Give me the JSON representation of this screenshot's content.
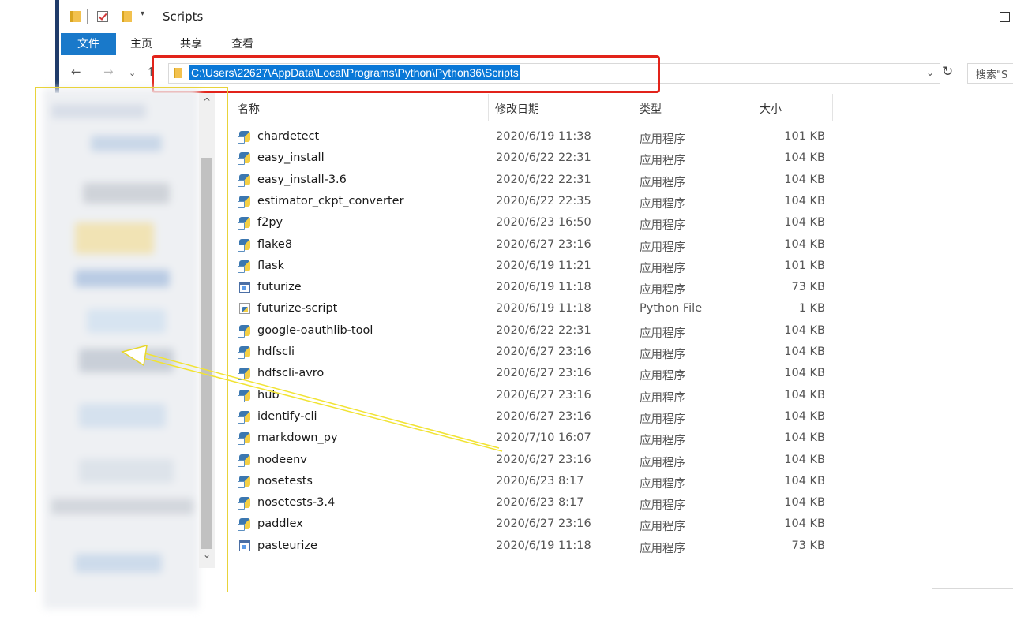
{
  "window": {
    "title": "Scripts",
    "quick_access_dropdown": "▾",
    "minimize_glyph": "",
    "maximize_glyph": ""
  },
  "ribbon": {
    "tabs": [
      {
        "label": "文件",
        "active": true
      },
      {
        "label": "主页",
        "active": false
      },
      {
        "label": "共享",
        "active": false
      },
      {
        "label": "查看",
        "active": false
      }
    ]
  },
  "navigation": {
    "back": "←",
    "forward": "→",
    "recent": "⌄",
    "up": "↑",
    "address": "C:\\Users\\22627\\AppData\\Local\\Programs\\Python\\Python36\\Scripts",
    "address_dropdown": "⌄",
    "refresh": "↻",
    "search_placeholder": "搜索\"S"
  },
  "nav_scrollbar": {
    "up": "^",
    "down": "⌄"
  },
  "columns": {
    "name": "名称",
    "date": "修改日期",
    "type": "类型",
    "size": "大小"
  },
  "files": [
    {
      "name": "chardetect",
      "date": "2020/6/19 11:38",
      "type": "应用程序",
      "size": "101 KB",
      "icon": "python-exe-icon"
    },
    {
      "name": "easy_install",
      "date": "2020/6/22 22:31",
      "type": "应用程序",
      "size": "104 KB",
      "icon": "python-exe-icon"
    },
    {
      "name": "easy_install-3.6",
      "date": "2020/6/22 22:31",
      "type": "应用程序",
      "size": "104 KB",
      "icon": "python-exe-icon"
    },
    {
      "name": "estimator_ckpt_converter",
      "date": "2020/6/22 22:35",
      "type": "应用程序",
      "size": "104 KB",
      "icon": "python-exe-icon"
    },
    {
      "name": "f2py",
      "date": "2020/6/23 16:50",
      "type": "应用程序",
      "size": "104 KB",
      "icon": "python-exe-icon"
    },
    {
      "name": "flake8",
      "date": "2020/6/27 23:16",
      "type": "应用程序",
      "size": "104 KB",
      "icon": "python-exe-icon"
    },
    {
      "name": "flask",
      "date": "2020/6/19 11:21",
      "type": "应用程序",
      "size": "101 KB",
      "icon": "python-exe-icon"
    },
    {
      "name": "futurize",
      "date": "2020/6/19 11:18",
      "type": "应用程序",
      "size": "73 KB",
      "icon": "window-exe-icon"
    },
    {
      "name": "futurize-script",
      "date": "2020/6/19 11:18",
      "type": "Python File",
      "size": "1 KB",
      "icon": "python-file-icon"
    },
    {
      "name": "google-oauthlib-tool",
      "date": "2020/6/22 22:31",
      "type": "应用程序",
      "size": "104 KB",
      "icon": "python-exe-icon"
    },
    {
      "name": "hdfscli",
      "date": "2020/6/27 23:16",
      "type": "应用程序",
      "size": "104 KB",
      "icon": "python-exe-icon"
    },
    {
      "name": "hdfscli-avro",
      "date": "2020/6/27 23:16",
      "type": "应用程序",
      "size": "104 KB",
      "icon": "python-exe-icon"
    },
    {
      "name": "hub",
      "date": "2020/6/27 23:16",
      "type": "应用程序",
      "size": "104 KB",
      "icon": "python-exe-icon"
    },
    {
      "name": "identify-cli",
      "date": "2020/6/27 23:16",
      "type": "应用程序",
      "size": "104 KB",
      "icon": "python-exe-icon"
    },
    {
      "name": "markdown_py",
      "date": "2020/7/10 16:07",
      "type": "应用程序",
      "size": "104 KB",
      "icon": "python-exe-icon"
    },
    {
      "name": "nodeenv",
      "date": "2020/6/27 23:16",
      "type": "应用程序",
      "size": "104 KB",
      "icon": "python-exe-icon"
    },
    {
      "name": "nosetests",
      "date": "2020/6/23 8:17",
      "type": "应用程序",
      "size": "104 KB",
      "icon": "python-exe-icon"
    },
    {
      "name": "nosetests-3.4",
      "date": "2020/6/23 8:17",
      "type": "应用程序",
      "size": "104 KB",
      "icon": "python-exe-icon"
    },
    {
      "name": "paddlex",
      "date": "2020/6/27 23:16",
      "type": "应用程序",
      "size": "104 KB",
      "icon": "python-exe-icon"
    },
    {
      "name": "pasteurize",
      "date": "2020/6/19 11:18",
      "type": "应用程序",
      "size": "73 KB",
      "icon": "window-exe-icon"
    }
  ],
  "colors": {
    "accent": "#1979ca",
    "selection": "#0a78d7",
    "highlight_box": "#e2231a",
    "annotation_arrow": "#f1e332"
  }
}
